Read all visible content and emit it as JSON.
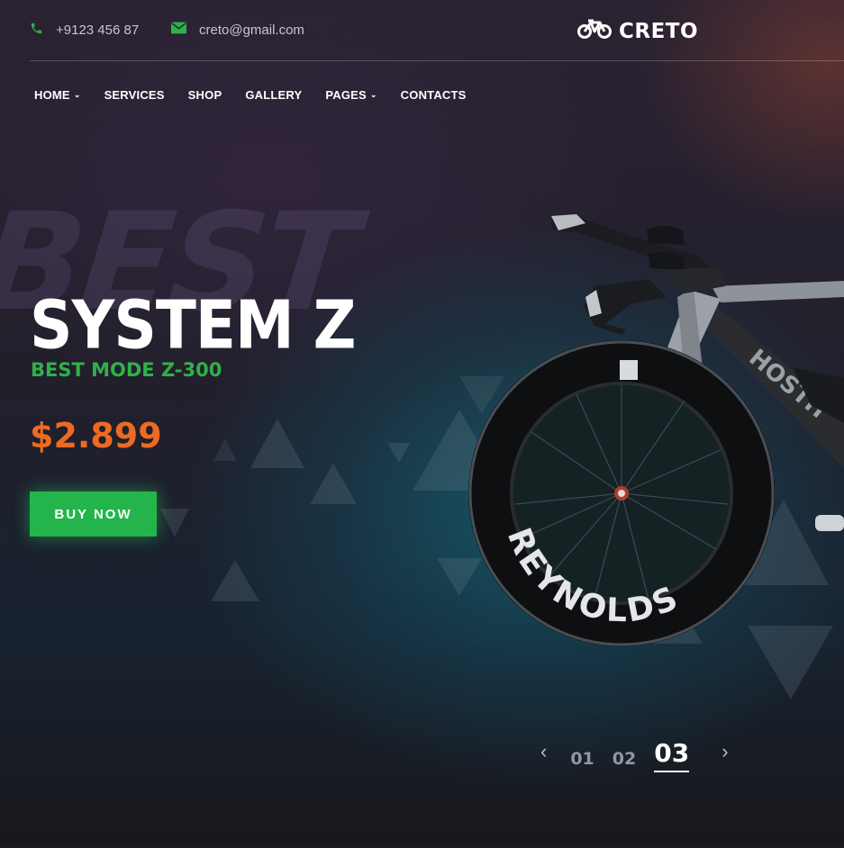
{
  "topbar": {
    "phone": "+9123 456 87",
    "email": "creto@gmail.com",
    "brand": "CRETO",
    "icons": {
      "phone": "phone-icon",
      "email": "envelope-icon",
      "logo": "bicycle-icon"
    },
    "accent_color": "#2fb14a"
  },
  "nav": {
    "items": [
      {
        "label": "HOME",
        "has_dropdown": true
      },
      {
        "label": "SERVICES",
        "has_dropdown": false
      },
      {
        "label": "SHOP",
        "has_dropdown": false
      },
      {
        "label": "GALLERY",
        "has_dropdown": false
      },
      {
        "label": "PAGES",
        "has_dropdown": true
      },
      {
        "label": "CONTACTS",
        "has_dropdown": false
      }
    ]
  },
  "hero": {
    "background_word": "BEST",
    "title": "SYSTEM Z",
    "subtitle": "BEST MODE Z-300",
    "price": "$2.899",
    "cta_label": "BUY NOW",
    "colors": {
      "subtitle": "#2fb14a",
      "price": "#ee6a22",
      "cta": "#23b54c"
    },
    "wheel_text": "REYNOLDS"
  },
  "slider": {
    "prev_icon": "chevron-left-icon",
    "next_icon": "chevron-right-icon",
    "slides": [
      "01",
      "02",
      "03"
    ],
    "active": "03"
  }
}
